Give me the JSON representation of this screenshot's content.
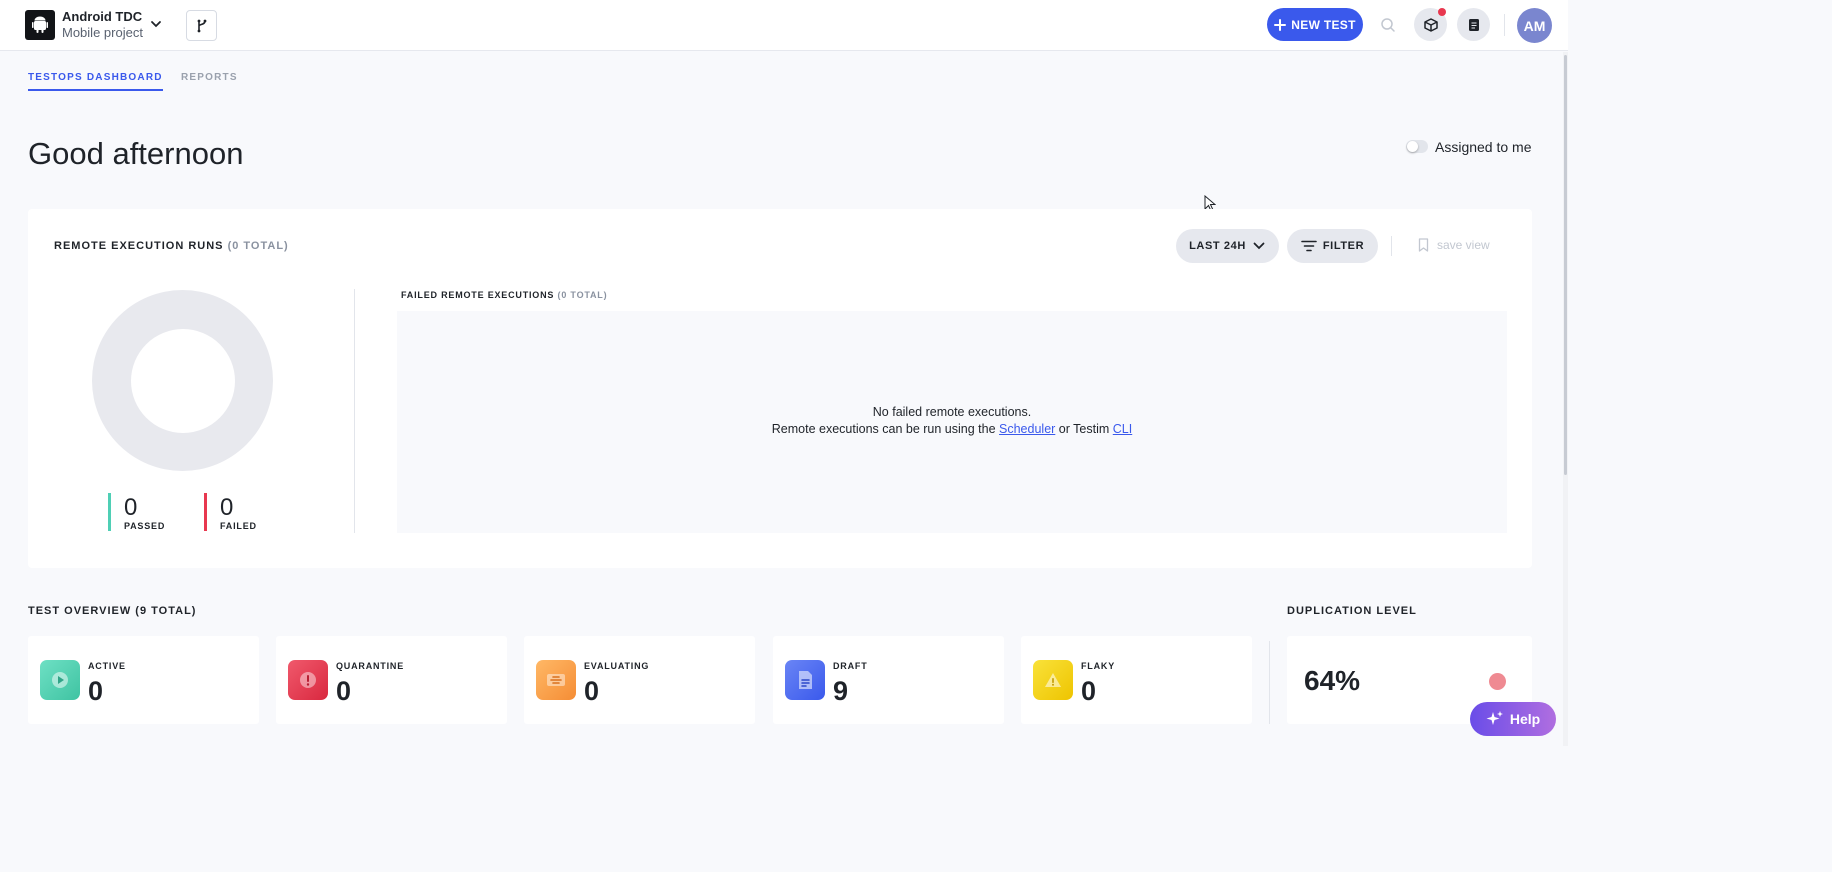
{
  "header": {
    "project_name": "Android TDC",
    "project_type": "Mobile project",
    "new_test_label": "NEW TEST",
    "avatar_initials": "AM",
    "accent_color": "#3a59ec"
  },
  "tabs": [
    {
      "label": "TESTOPS DASHBOARD",
      "active": true
    },
    {
      "label": "REPORTS",
      "active": false
    }
  ],
  "greeting": "Good afternoon",
  "assigned_toggle": {
    "label": "Assigned to me",
    "on": false
  },
  "remote_runs": {
    "title": "REMOTE EXECUTION RUNS",
    "total_label": "(0 TOTAL)",
    "range_label": "LAST 24H",
    "filter_label": "FILTER",
    "save_view_label": "save view",
    "passed": {
      "value": "0",
      "label": "PASSED",
      "color": "#4fcfb5"
    },
    "failed": {
      "value": "0",
      "label": "FAILED",
      "color": "#e8384f"
    }
  },
  "failed_executions": {
    "title": "FAILED REMOTE EXECUTIONS",
    "total_label": "(0 TOTAL)",
    "empty_line1": "No failed remote executions.",
    "empty_prefix": "Remote executions can be run using the",
    "scheduler_link": "Scheduler",
    "or_text": "or Testim",
    "cli_link": "CLI"
  },
  "test_overview": {
    "title": "TEST OVERVIEW (9 TOTAL)",
    "items": [
      {
        "label": "ACTIVE",
        "value": "0",
        "icon": "play-icon",
        "color": "#4fd1b0"
      },
      {
        "label": "QUARANTINE",
        "value": "0",
        "icon": "alert-icon",
        "color": "#e8384f"
      },
      {
        "label": "EVALUATING",
        "value": "0",
        "icon": "evaluate-icon",
        "color": "#f7a24b"
      },
      {
        "label": "DRAFT",
        "value": "9",
        "icon": "draft-icon",
        "color": "#4a63e8"
      },
      {
        "label": "FLAKY",
        "value": "0",
        "icon": "warning-icon",
        "color": "#f2d40c"
      }
    ]
  },
  "duplication": {
    "title": "DUPLICATION LEVEL",
    "value": "64%",
    "status_color": "#ef8a92"
  },
  "help": {
    "label": "Help"
  }
}
